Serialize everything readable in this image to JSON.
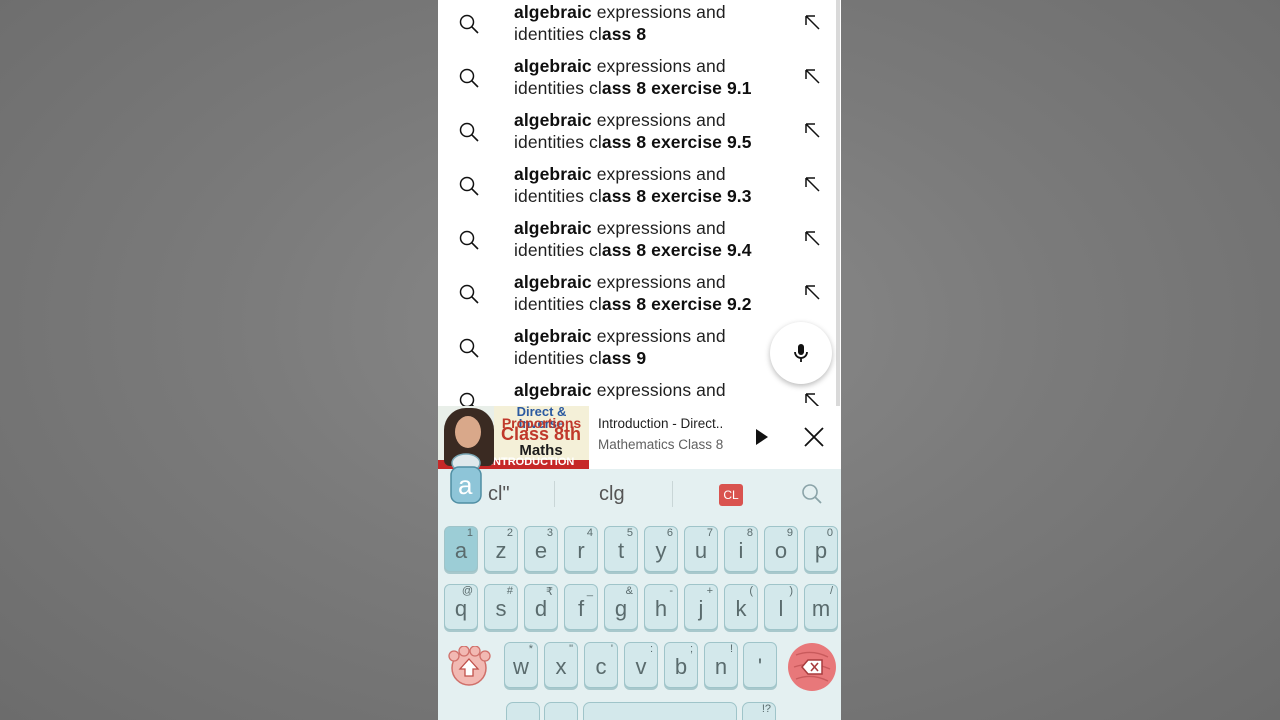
{
  "suggestions": [
    {
      "bold_prefix": "algebraic",
      "rest_line1": " expressions and",
      "line2_plain": "identities cl",
      "line2_bold": "ass 8"
    },
    {
      "bold_prefix": "algebraic",
      "rest_line1": " expressions and",
      "line2_plain": "identities cl",
      "line2_bold": "ass 8 exercise 9.1"
    },
    {
      "bold_prefix": "algebraic",
      "rest_line1": " expressions and",
      "line2_plain": "identities cl",
      "line2_bold": "ass 8 exercise 9.5"
    },
    {
      "bold_prefix": "algebraic",
      "rest_line1": " expressions and",
      "line2_plain": "identities cl",
      "line2_bold": "ass 8 exercise 9.3"
    },
    {
      "bold_prefix": "algebraic",
      "rest_line1": " expressions and",
      "line2_plain": "identities cl",
      "line2_bold": "ass 8 exercise 9.4"
    },
    {
      "bold_prefix": "algebraic",
      "rest_line1": " expressions and",
      "line2_plain": "identities cl",
      "line2_bold": "ass 8 exercise 9.2"
    },
    {
      "bold_prefix": "algebraic",
      "rest_line1": " expressions and",
      "line2_plain": "identities cl",
      "line2_bold": "ass 9"
    },
    {
      "bold_prefix": "algebraic",
      "rest_line1": " expressions and",
      "line2_plain": "",
      "line2_bold": ""
    }
  ],
  "icons": {
    "suggestion_left": "search-icon",
    "suggestion_right": "arrow-up-left-icon",
    "fab": "mic-icon",
    "player_play": "play-icon",
    "player_close": "close-icon",
    "keyboard_search": "search-icon",
    "shift": "shift-icon",
    "backspace": "backspace-icon"
  },
  "miniplayer": {
    "title": "Introduction - Direct..",
    "channel": "Mathematics Class 8",
    "thumb_line1": "Direct & Inverse",
    "thumb_line2": "Proportions",
    "thumb_class": "Class 8th",
    "thumb_maths": "Maths",
    "thumb_band": "INTRODUCTION"
  },
  "keyboard": {
    "mascot_letter": "a",
    "suggest_1": "cl\"",
    "suggest_2": "clg",
    "suggest_badge": "CL",
    "row1": [
      {
        "k": "a",
        "alt": "1"
      },
      {
        "k": "z",
        "alt": "2"
      },
      {
        "k": "e",
        "alt": "3"
      },
      {
        "k": "r",
        "alt": "4"
      },
      {
        "k": "t",
        "alt": "5"
      },
      {
        "k": "y",
        "alt": "6"
      },
      {
        "k": "u",
        "alt": "7"
      },
      {
        "k": "i",
        "alt": "8"
      },
      {
        "k": "o",
        "alt": "9"
      },
      {
        "k": "p",
        "alt": "0"
      }
    ],
    "row2": [
      {
        "k": "q",
        "alt": "@"
      },
      {
        "k": "s",
        "alt": "#"
      },
      {
        "k": "d",
        "alt": "₹"
      },
      {
        "k": "f",
        "alt": "_"
      },
      {
        "k": "g",
        "alt": "&"
      },
      {
        "k": "h",
        "alt": "-"
      },
      {
        "k": "j",
        "alt": "+"
      },
      {
        "k": "k",
        "alt": "("
      },
      {
        "k": "l",
        "alt": ")"
      },
      {
        "k": "m",
        "alt": "/"
      }
    ],
    "row3": [
      {
        "k": "w",
        "alt": "*"
      },
      {
        "k": "x",
        "alt": "\""
      },
      {
        "k": "c",
        "alt": "'"
      },
      {
        "k": "v",
        "alt": ":"
      },
      {
        "k": "b",
        "alt": ";"
      },
      {
        "k": "n",
        "alt": "!"
      },
      {
        "k": "'",
        "alt": ""
      }
    ],
    "bottom_alt": "!?"
  },
  "colors": {
    "keyboard_bg": "#e4f0f1",
    "key_fill": "#d3e8eb",
    "backspace": "#e8787a",
    "badge": "#d9534f"
  }
}
